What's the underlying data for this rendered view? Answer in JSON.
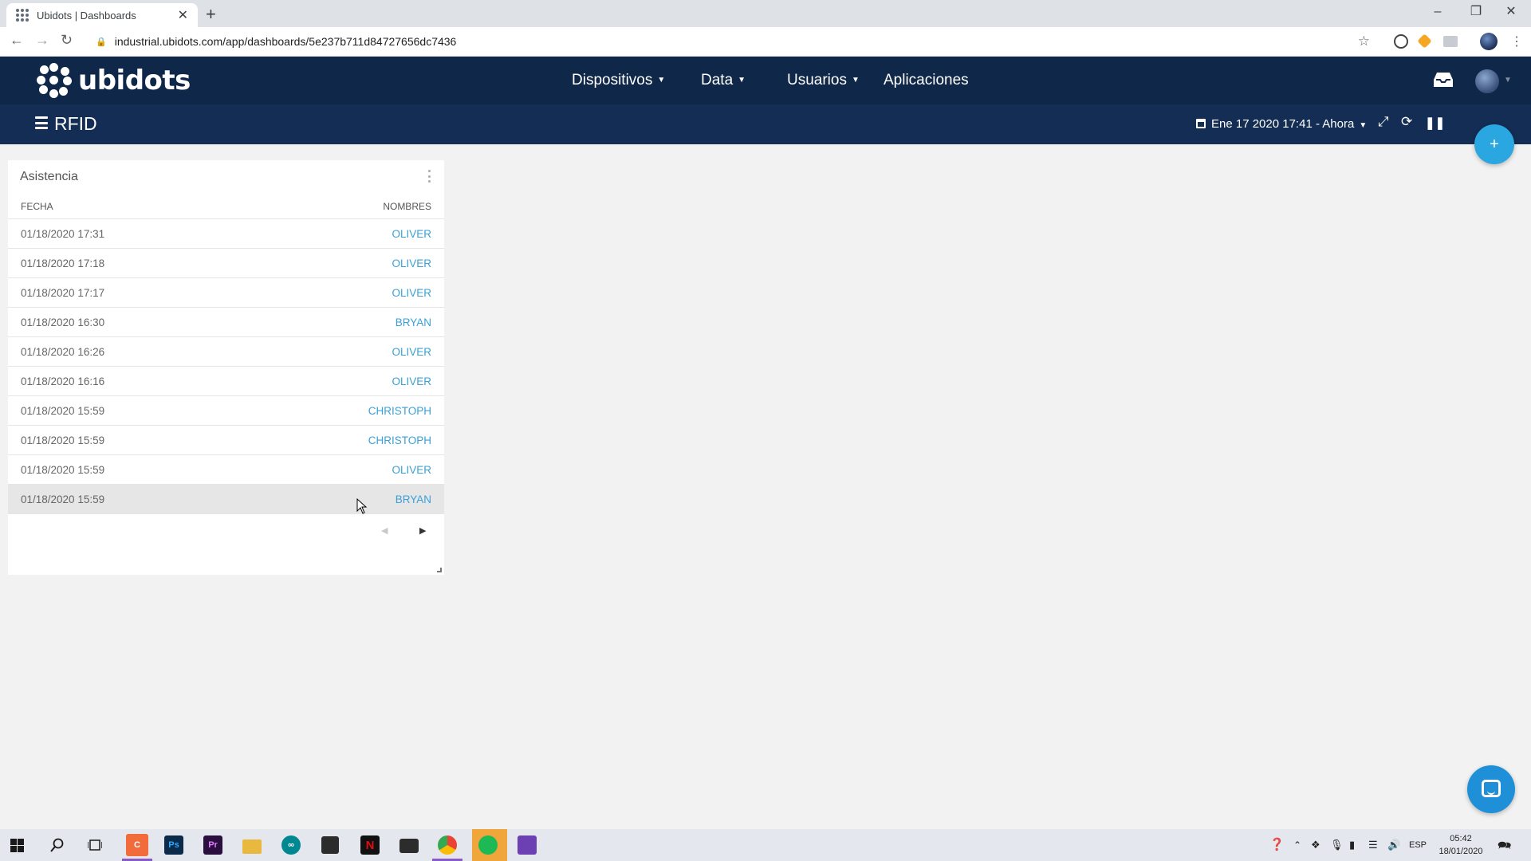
{
  "browser": {
    "tab_title": "Ubidots | Dashboards",
    "tab_close": "✕",
    "new_tab": "+",
    "url": "industrial.ubidots.com/app/dashboards/5e237b711d84727656dc7436",
    "window_minimize": "–",
    "window_restore": "❐",
    "window_close": "✕"
  },
  "header": {
    "logo": "ubidots",
    "menu": [
      {
        "label": "Dispositivos",
        "caret": "▼"
      },
      {
        "label": "Data",
        "caret": "▼"
      },
      {
        "label": "Usuarios",
        "caret": "▼"
      },
      {
        "label": "Aplicaciones"
      }
    ]
  },
  "dashboard": {
    "title": "RFID",
    "date_range": "Ene 17 2020 17:41 - Ahora",
    "add_button": "+"
  },
  "widget": {
    "title": "Asistencia",
    "columns": [
      "FECHA",
      "NOMBRES"
    ],
    "rows": [
      {
        "fecha": "01/18/2020 17:31",
        "nombre": "OLIVER"
      },
      {
        "fecha": "01/18/2020 17:18",
        "nombre": "OLIVER"
      },
      {
        "fecha": "01/18/2020 17:17",
        "nombre": "OLIVER"
      },
      {
        "fecha": "01/18/2020 16:30",
        "nombre": "BRYAN"
      },
      {
        "fecha": "01/18/2020 16:26",
        "nombre": "OLIVER"
      },
      {
        "fecha": "01/18/2020 16:16",
        "nombre": "OLIVER"
      },
      {
        "fecha": "01/18/2020 15:59",
        "nombre": "CHRISTOPH"
      },
      {
        "fecha": "01/18/2020 15:59",
        "nombre": "CHRISTOPH"
      },
      {
        "fecha": "01/18/2020 15:59",
        "nombre": "OLIVER"
      },
      {
        "fecha": "01/18/2020 15:59",
        "nombre": "BRYAN"
      }
    ],
    "pager_prev": "◀",
    "pager_next": "▶"
  },
  "taskbar": {
    "apps": [
      "start-icon",
      "search-icon",
      "task-view-icon",
      "app-icon",
      "photoshop-icon",
      "premiere-icon",
      "file-explorer-icon",
      "arduino-icon",
      "store-icon",
      "netflix-icon",
      "mail-icon",
      "chrome-icon",
      "spotify-icon",
      "whatsapp-icon"
    ],
    "language": "ESP",
    "time": "05:42",
    "date": "18/01/2020"
  },
  "colors": {
    "header_bg": "#0f2749",
    "subbar_bg": "#142d54",
    "accent": "#2aa6e0",
    "link": "#3aa0d5"
  }
}
